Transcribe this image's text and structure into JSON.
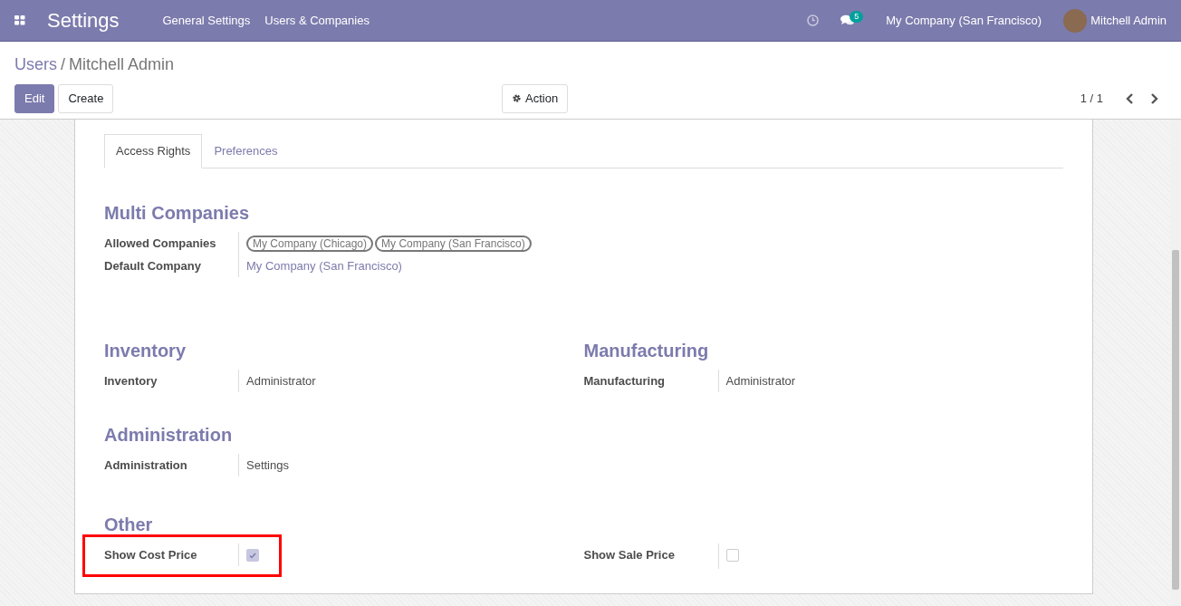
{
  "navbar": {
    "app_title": "Settings",
    "menu": [
      "General Settings",
      "Users & Companies"
    ],
    "messages_badge": "5",
    "company": "My Company (San Francisco)",
    "user": "Mitchell Admin"
  },
  "breadcrumb": [
    {
      "label": "Users",
      "link": true
    },
    {
      "label": "Mitchell Admin",
      "link": false
    }
  ],
  "breadcrumb_separator": "/",
  "buttons": [
    {
      "label": "Edit",
      "kind": "primary"
    },
    {
      "label": "Create",
      "kind": "secondary"
    }
  ],
  "action_button": "Action",
  "pager": "1 / 1",
  "tabs": [
    {
      "label": "Access Rights",
      "selected": true
    },
    {
      "label": "Preferences",
      "selected": false
    }
  ],
  "sections": [
    {
      "columns": [
        {
          "title": "Multi Companies",
          "fields": [
            {
              "label": "Allowed Companies",
              "kind": "tags",
              "tags": [
                "My Company (Chicago)",
                "My Company (San Francisco)"
              ]
            },
            {
              "label": "Default Company",
              "kind": "link",
              "value": "My Company (San Francisco)"
            }
          ]
        }
      ]
    },
    {
      "columns": [
        {
          "title": "Inventory",
          "fields": [
            {
              "label": "Inventory",
              "kind": "text",
              "value": "Administrator"
            }
          ]
        },
        {
          "title": "Manufacturing",
          "fields": [
            {
              "label": "Manufacturing",
              "kind": "text",
              "value": "Administrator"
            }
          ]
        }
      ]
    },
    {
      "columns": [
        {
          "title": "Administration",
          "fields": [
            {
              "label": "Administration",
              "kind": "text",
              "value": "Settings"
            }
          ]
        }
      ]
    },
    {
      "title": "Other",
      "columns": [
        {
          "fields": [
            {
              "label": "Show Cost Price",
              "kind": "checkbox",
              "checked": true,
              "highlighted": true
            }
          ]
        },
        {
          "fields": [
            {
              "label": "Show Sale Price",
              "kind": "checkbox",
              "checked": false,
              "highlighted": false
            }
          ]
        }
      ]
    }
  ]
}
